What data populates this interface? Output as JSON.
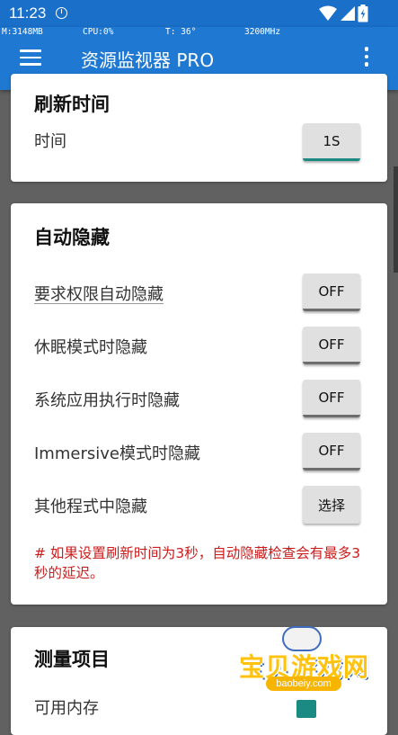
{
  "status_bar": {
    "time": "11:23"
  },
  "overlay": {
    "mem": "M:3148MB",
    "cpu": "CPU:0%",
    "temp": "T: 36°",
    "freq": "3200MHz"
  },
  "app_bar": {
    "title": "资源监视器 PRO"
  },
  "refresh_card": {
    "title": "刷新时间",
    "label": "时间",
    "value": "1S"
  },
  "autohide_card": {
    "title": "自动隐藏",
    "rows": [
      {
        "label": "要求权限自动隐藏",
        "value": "OFF"
      },
      {
        "label": "休眠模式时隐藏",
        "value": "OFF"
      },
      {
        "label": "系统应用执行时隐藏",
        "value": "OFF"
      },
      {
        "label": "Immersive模式时隐藏",
        "value": "OFF"
      },
      {
        "label": "其他程式中隐藏",
        "value": "选择"
      }
    ],
    "note": "# 如果设置刷新时间为3秒，自动隐藏检查会有最多3秒的延迟。"
  },
  "measure_card": {
    "title": "测量项目",
    "first_item": "可用内存",
    "first_item_checked": true
  },
  "watermark": {
    "brand": "宝贝游戏网",
    "url": "baobeiy.com"
  },
  "colors": {
    "app_bar": "#1f78d1",
    "status_bar": "#1a6fc8",
    "note_text": "#cc1c1c",
    "accent": "#1b8a83"
  },
  "icons": [
    "clock-icon",
    "wifi-icon",
    "cell-signal-icon",
    "battery-icon",
    "menu-icon",
    "more-vert-icon",
    "checkbox-checked-icon",
    "gamepad-icon"
  ]
}
